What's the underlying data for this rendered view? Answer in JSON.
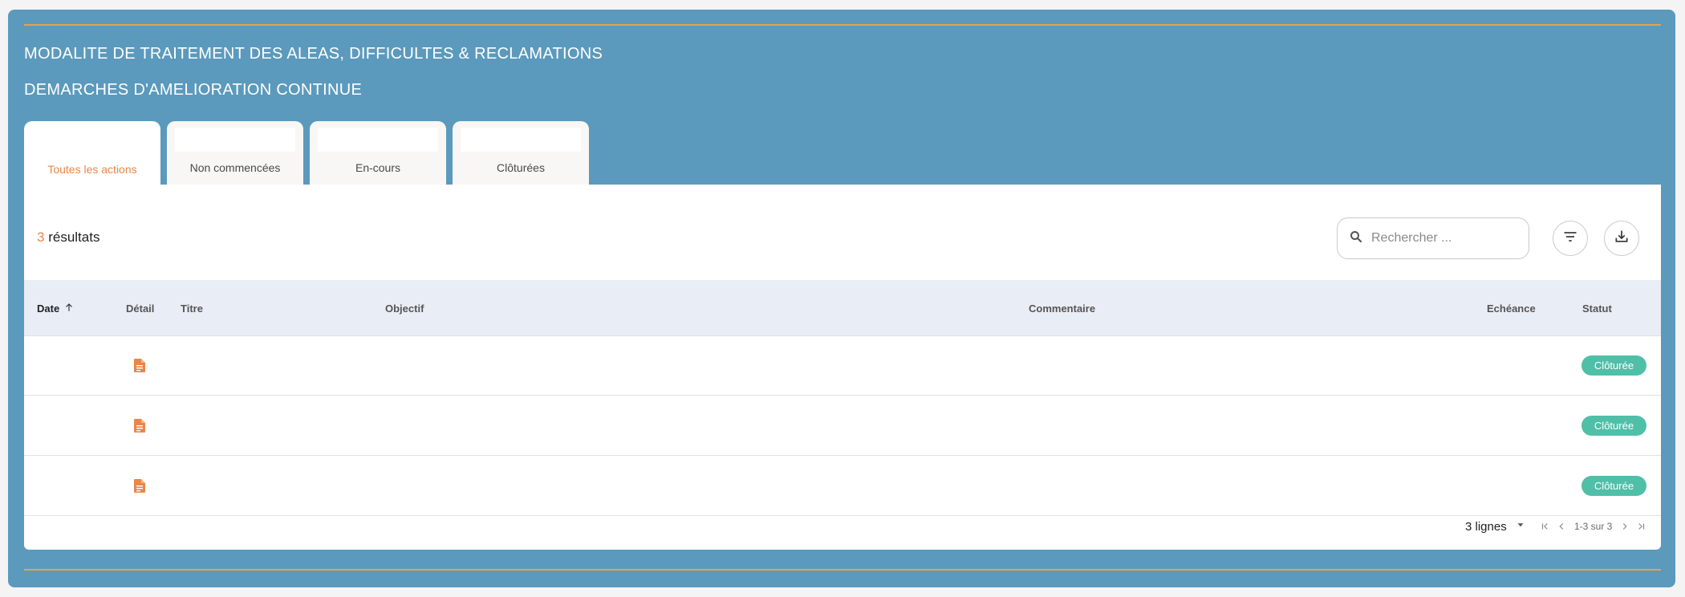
{
  "sections": {
    "title_1": "MODALITE DE TRAITEMENT DES ALEAS, DIFFICULTES & RECLAMATIONS",
    "title_2": "DEMARCHES D'AMELIORATION CONTINUE"
  },
  "tabs": [
    {
      "label": "Toutes les actions",
      "active": true
    },
    {
      "label": "Non commencées",
      "active": false
    },
    {
      "label": "En-cours",
      "active": false
    },
    {
      "label": "Clôturées",
      "active": false
    }
  ],
  "results": {
    "count": "3",
    "label": "résultats"
  },
  "search": {
    "placeholder": "Rechercher ...",
    "value": ""
  },
  "toolbar": {
    "filter_icon": "filter-icon",
    "download_icon": "download-icon"
  },
  "table": {
    "columns": {
      "date": "Date",
      "detail": "Détail",
      "titre": "Titre",
      "objectif": "Objectif",
      "commentaire": "Commentaire",
      "echeance": "Echéance",
      "statut": "Statut"
    },
    "sort": {
      "column": "date",
      "direction": "asc"
    },
    "rows": [
      {
        "date": "",
        "detail_icon": "document-icon",
        "titre": "",
        "objectif": "",
        "commentaire": "",
        "echeance": "",
        "statut": "Clôturée"
      },
      {
        "date": "",
        "detail_icon": "document-icon",
        "titre": "",
        "objectif": "",
        "commentaire": "",
        "echeance": "",
        "statut": "Clôturée"
      },
      {
        "date": "",
        "detail_icon": "document-icon",
        "titre": "",
        "objectif": "",
        "commentaire": "",
        "echeance": "",
        "statut": "Clôturée"
      }
    ]
  },
  "pagination": {
    "rows_per_page": "3 lignes",
    "range": "1-3 sur 3"
  },
  "colors": {
    "panel": "#5b9abd",
    "accent_line": "#e3a34a",
    "accent_orange": "#e8874a",
    "status_closed": "#4fbfa8",
    "table_header": "#e9edf5"
  }
}
